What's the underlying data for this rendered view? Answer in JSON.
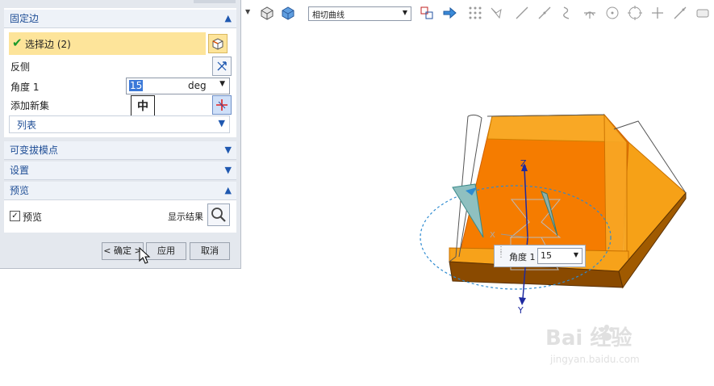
{
  "dialog": {
    "section_fixed_edge": "固定边",
    "select_edge": "选择边 (2)",
    "reverse": "反侧",
    "angle_label": "角度 1",
    "angle_value": "15",
    "angle_unit": "deg",
    "add_set": "添加新集",
    "ime_char": "中",
    "list": "列表",
    "section_variable": "可变拔模点",
    "section_settings": "设置",
    "section_preview": "预览",
    "preview_checkbox": "预览",
    "show_result": "显示结果",
    "ok": "< 确定 >",
    "apply": "应用",
    "cancel": "取消"
  },
  "toolbar": {
    "curve_select": "相切曲线"
  },
  "viewport": {
    "float_label": "角度 1",
    "float_value": "15",
    "axis_z": "Z",
    "axis_y": "Y",
    "axis_x": "X"
  },
  "watermark": {
    "brand": "Bai 经验",
    "url": "jingyan.baidu.com"
  },
  "colors": {
    "accent_blue": "#1f58b0",
    "part_orange": "#f57c00",
    "part_light": "#f9a825",
    "part_dark": "#8a4a00",
    "highlight": "#fde49a"
  }
}
